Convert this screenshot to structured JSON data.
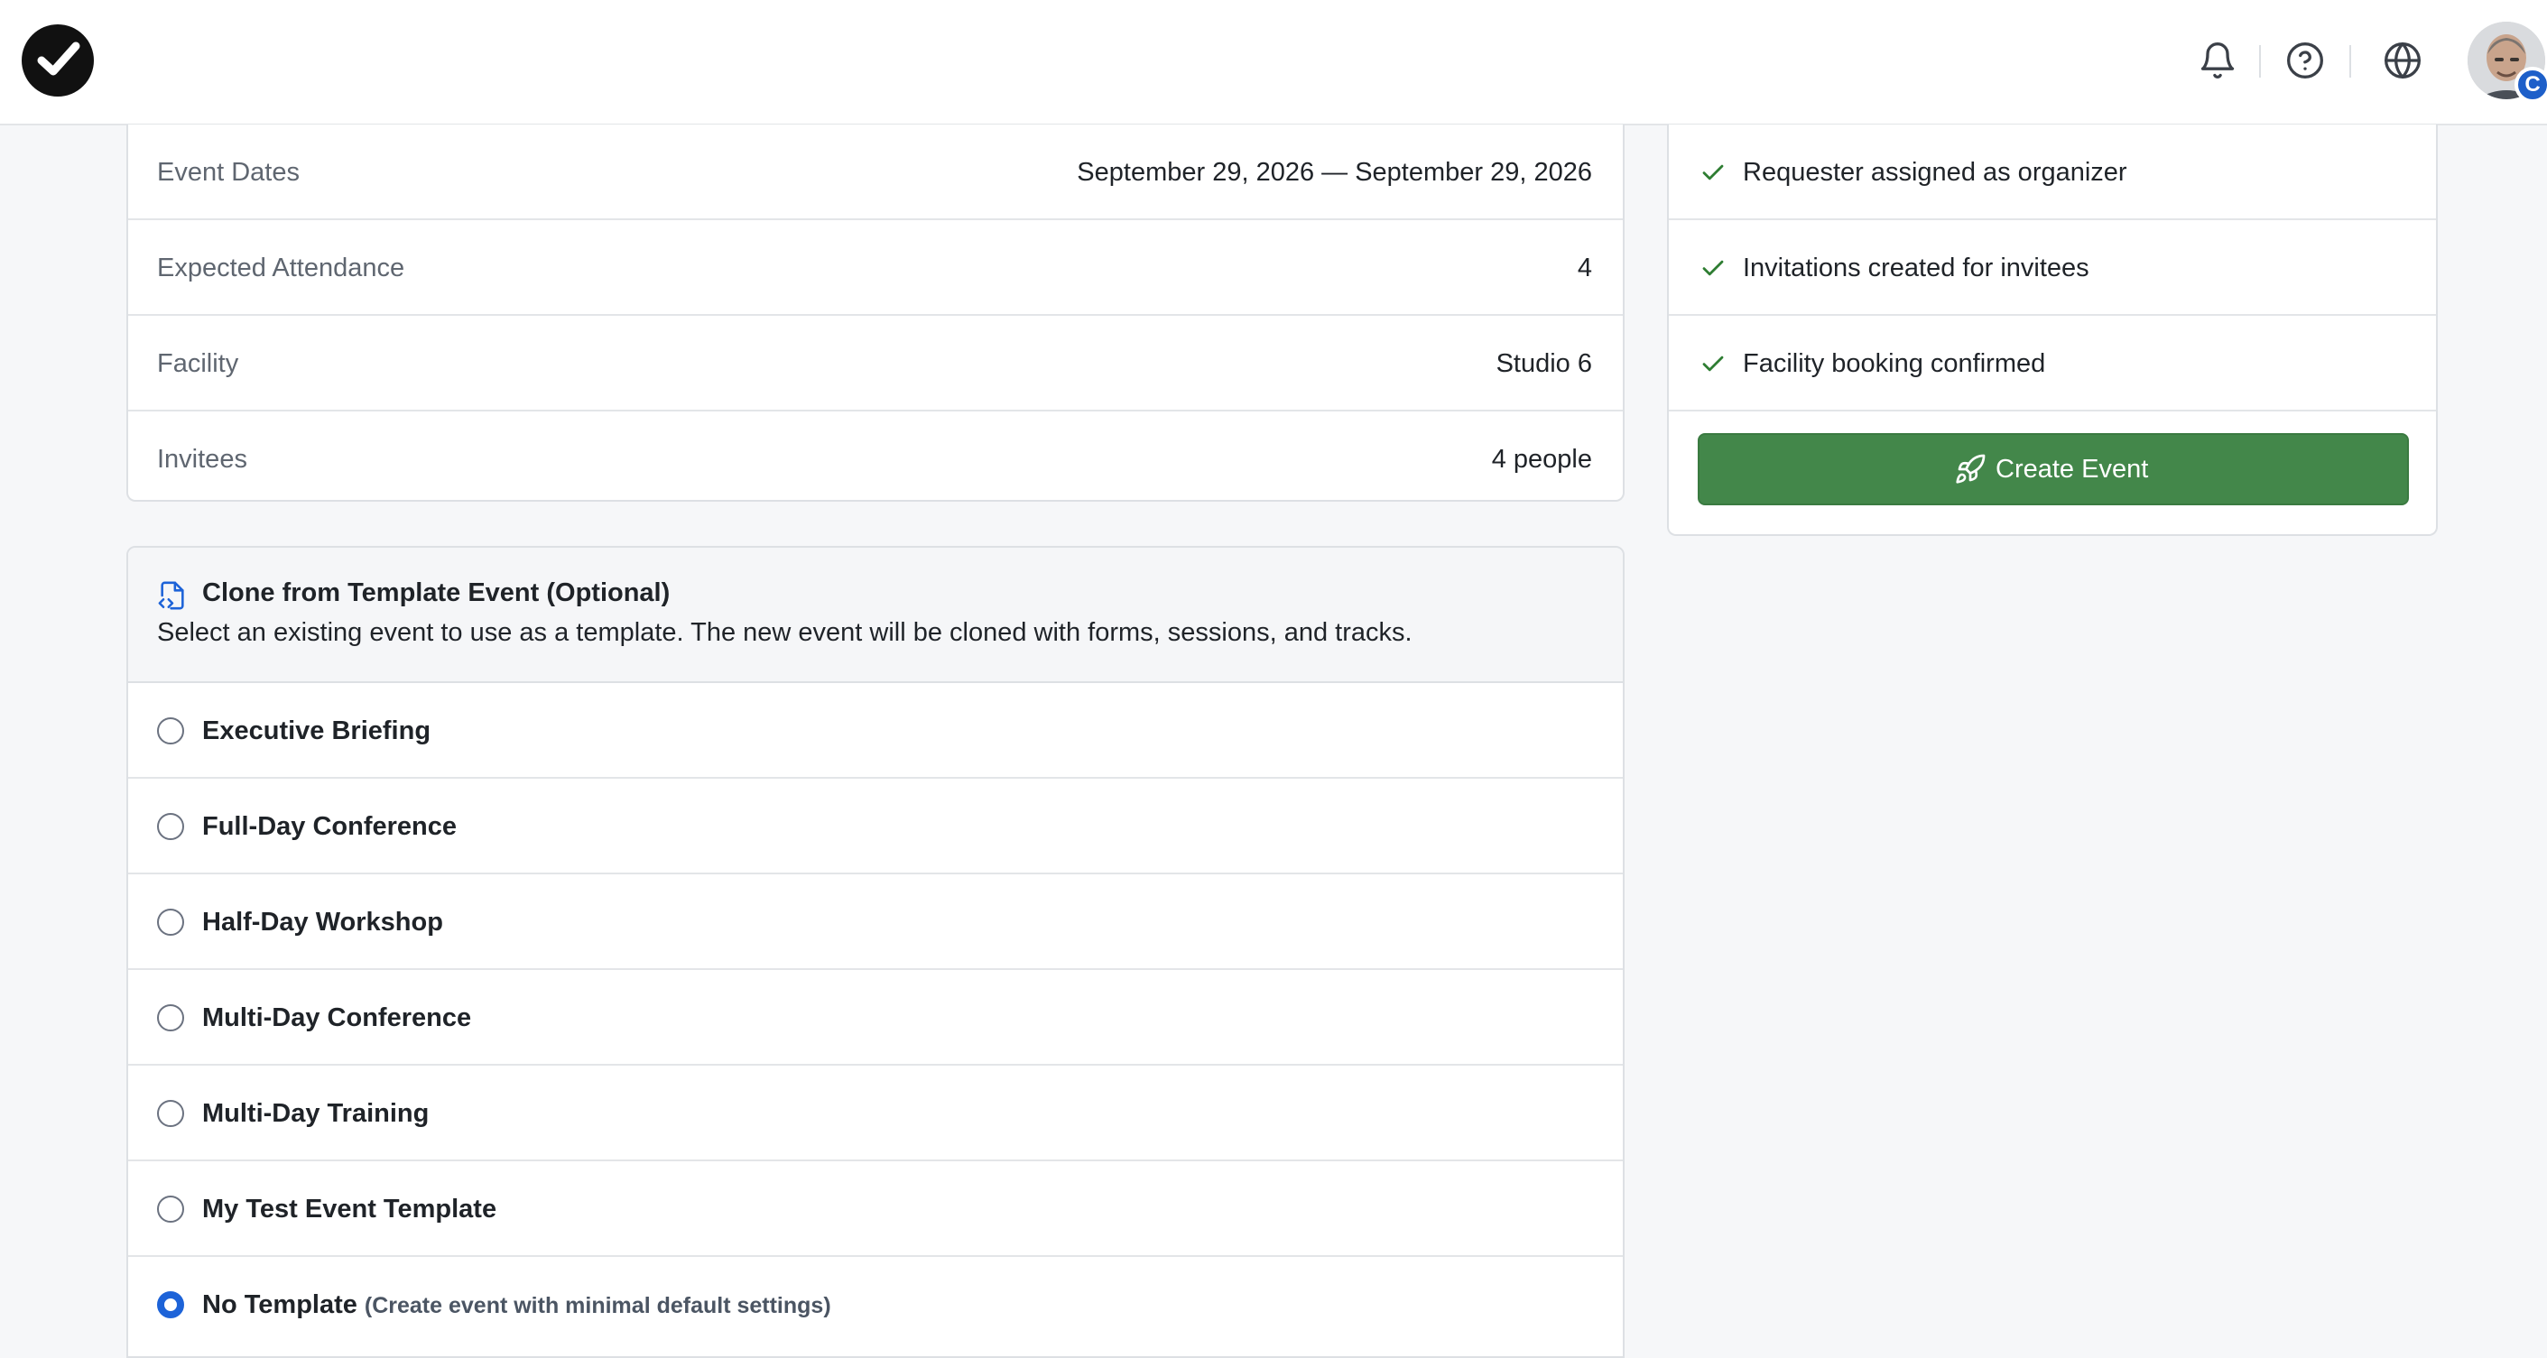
{
  "colors": {
    "accent": "#1d63d8",
    "success": "#2e7d32",
    "primary_button": "#43874a"
  },
  "header": {
    "icons": [
      "logo-check-icon",
      "bell-icon",
      "help-icon",
      "globe-icon"
    ],
    "avatar_badge": "C"
  },
  "summary": {
    "rows": [
      {
        "label": "Event Dates",
        "value": "September 29, 2026 — September 29, 2026"
      },
      {
        "label": "Expected Attendance",
        "value": "4"
      },
      {
        "label": "Facility",
        "value": "Studio 6"
      },
      {
        "label": "Invitees",
        "value": "4 people"
      }
    ]
  },
  "clone": {
    "icon": "file-code-icon",
    "title": "Clone from Template Event (Optional)",
    "subtitle": "Select an existing event to use as a template. The new event will be cloned with forms, sessions, and tracks.",
    "options": [
      {
        "label": "Executive Briefing",
        "note": "",
        "selected": false
      },
      {
        "label": "Full-Day Conference",
        "note": "",
        "selected": false
      },
      {
        "label": "Half-Day Workshop",
        "note": "",
        "selected": false
      },
      {
        "label": "Multi-Day Conference",
        "note": "",
        "selected": false
      },
      {
        "label": "Multi-Day Training",
        "note": "",
        "selected": false
      },
      {
        "label": "My Test Event Template",
        "note": "",
        "selected": false
      },
      {
        "label": "No Template",
        "note": "(Create event with minimal default settings)",
        "selected": true
      }
    ]
  },
  "checklist": {
    "items": [
      "Requester assigned as organizer",
      "Invitations created for invitees",
      "Facility booking confirmed"
    ],
    "create_button": {
      "label": "Create Event",
      "icon": "rocket-icon"
    }
  }
}
